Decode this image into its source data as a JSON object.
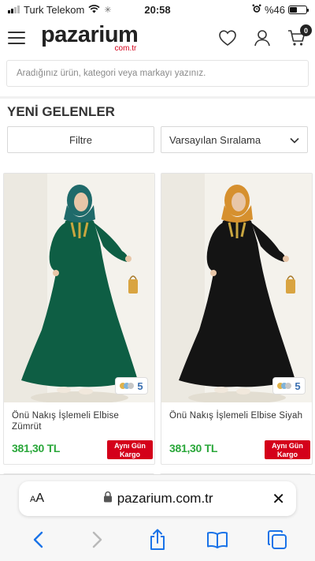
{
  "status_bar": {
    "carrier": "Turk Telekom",
    "time": "20:58",
    "battery_text": "%46",
    "battery_level": 0.46
  },
  "header": {
    "logo_text": "pazarium",
    "logo_domain": "com.tr",
    "cart_count": "0",
    "icons": [
      "hamburger-menu-icon",
      "heart-icon",
      "user-icon",
      "cart-icon"
    ]
  },
  "search": {
    "placeholder": "Aradığınız ürün, kategori veya markayı yazınız."
  },
  "section": {
    "title": "YENİ GELENLER",
    "filter_label": "Filtre",
    "sort_label": "Varsayılan Sıralama"
  },
  "products": [
    {
      "name": "Önü Nakış İşlemeli Elbise Zümrüt",
      "price": "381,30 TL",
      "color_count": "5",
      "badge_line1": "Aynı Gün",
      "badge_line2": "Kargo",
      "dress_color": "#0e5e44",
      "hijab_color": "#1f6a6a"
    },
    {
      "name": "Önü Nakış İşlemeli Elbise Siyah",
      "price": "381,30 TL",
      "color_count": "5",
      "badge_line1": "Aynı Gün",
      "badge_line2": "Kargo",
      "dress_color": "#141414",
      "hijab_color": "#d6902e"
    }
  ],
  "colors": {
    "price_green": "#2aa73a",
    "badge_red": "#d4001a",
    "accent_blue": "#3a6fb0"
  },
  "browser": {
    "aa_label": "AA",
    "url": "pazarium.com.tr",
    "toolbar_icons": [
      "back-icon",
      "forward-icon",
      "share-icon",
      "bookmarks-icon",
      "tabs-icon"
    ]
  }
}
